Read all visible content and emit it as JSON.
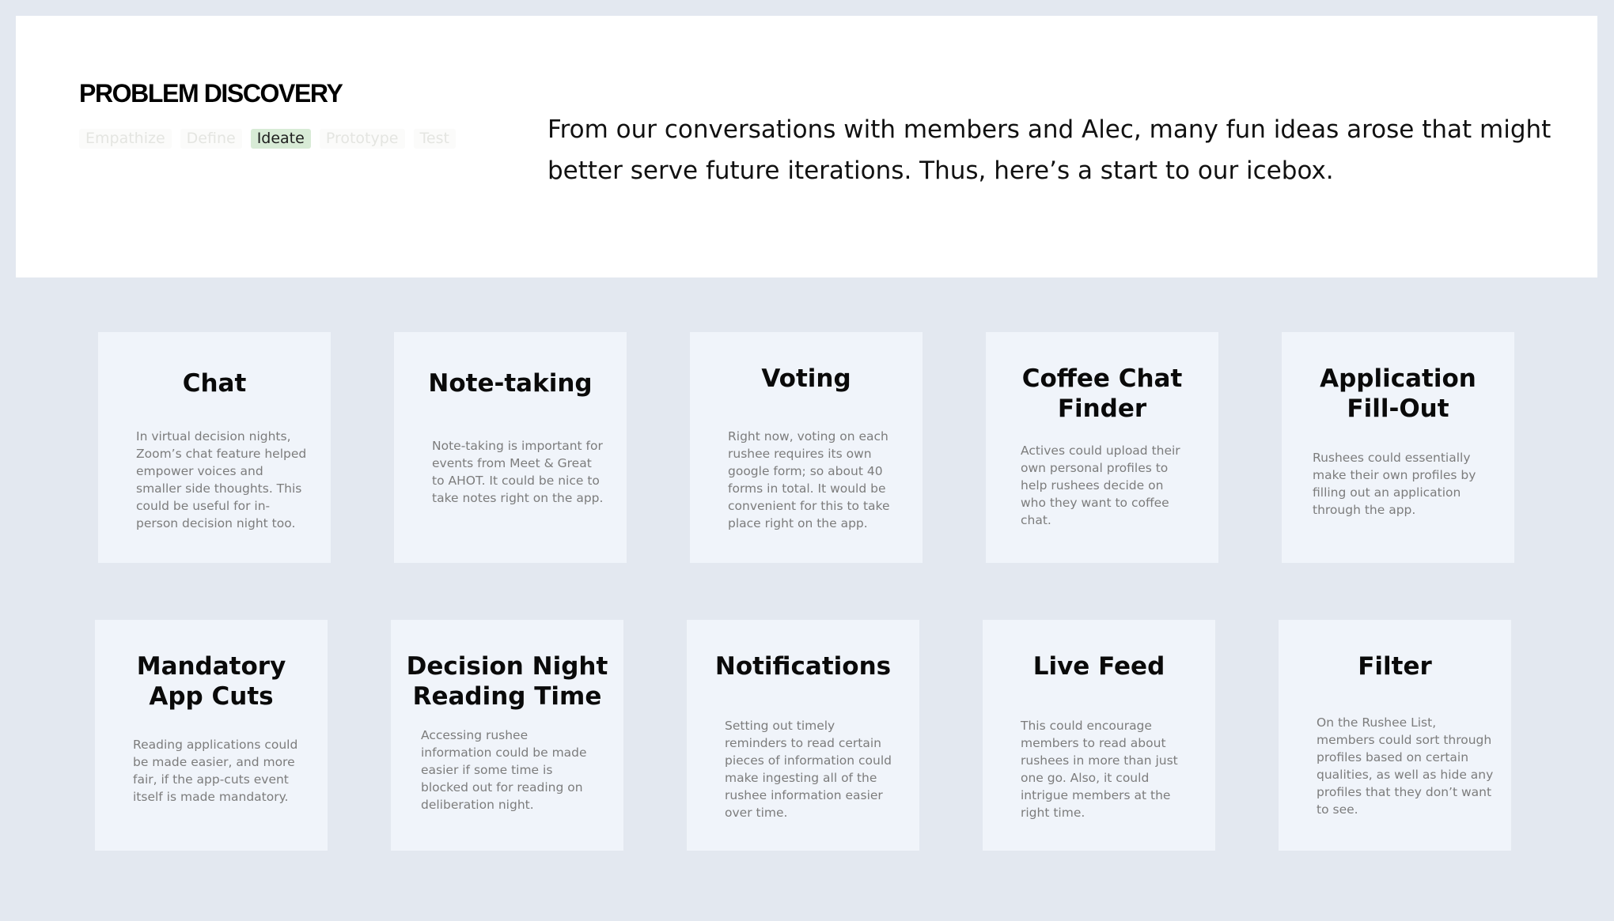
{
  "header": {
    "title": "PROBLEM DISCOVERY",
    "stages": [
      {
        "label": "Empathize",
        "active": false
      },
      {
        "label": "Define",
        "active": false
      },
      {
        "label": "Ideate",
        "active": true
      },
      {
        "label": "Prototype",
        "active": false
      },
      {
        "label": "Test",
        "active": false
      }
    ],
    "intro": "From our conversations with members and Alec, many fun ideas arose that might better serve future iterations. Thus, here’s a start to our icebox."
  },
  "ideas": [
    {
      "title": "Chat",
      "text": "In virtual decision nights, Zoom’s chat feature helped empower voices and smaller side thoughts. This could be useful for in-person decision night too."
    },
    {
      "title": "Note-taking",
      "text": "Note-taking is important for events from Meet & Great to AHOT. It could be nice to take notes right on the app."
    },
    {
      "title": "Voting",
      "text": "Right now, voting on each rushee requires its own google form; so about 40 forms in total. It would be convenient for this to take place right on the app."
    },
    {
      "title": "Coffee Chat Finder",
      "text": "Actives could upload their own personal profiles to help rushees decide on who they want to coffee chat."
    },
    {
      "title": "Application Fill-Out",
      "text": "Rushees could essentially make their own profiles by filling out an application through the app."
    },
    {
      "title": "Mandatory App Cuts",
      "text": "Reading applications could be made easier, and more fair, if the app-cuts event itself is made mandatory."
    },
    {
      "title": "Decision Night Reading Time",
      "text": "Accessing rushee information could be made easier if some time is blocked out for reading on deliberation night."
    },
    {
      "title": "Notifications",
      "text": "Setting out timely reminders to read certain pieces of information could make ingesting all of the rushee information easier over time."
    },
    {
      "title": "Live Feed",
      "text": "This could encourage members to read about rushees in more than just one go. Also, it could intrigue members at the right time."
    },
    {
      "title": "Filter",
      "text": "On the Rushee List, members could sort through profiles based on certain qualities, as well as hide any profiles that they don’t want to see."
    }
  ]
}
